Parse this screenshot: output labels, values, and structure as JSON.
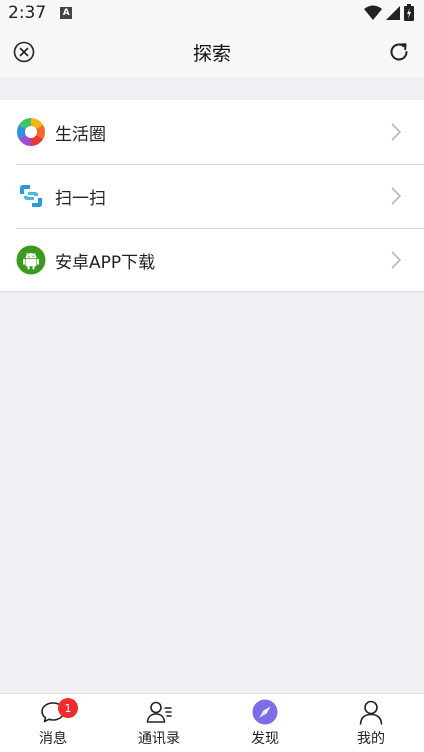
{
  "status_bar": {
    "time": "2:37",
    "notification_icon": "a-notification-icon"
  },
  "header": {
    "title": "探索",
    "left_icon": "close-circle-icon",
    "right_icon": "refresh-icon"
  },
  "menu": {
    "items": [
      {
        "label": "生活圈",
        "icon": "aperture-icon"
      },
      {
        "label": "扫一扫",
        "icon": "scan-icon"
      },
      {
        "label": "安卓APP下载",
        "icon": "android-icon"
      }
    ]
  },
  "tabbar": {
    "tabs": [
      {
        "label": "消息",
        "icon": "chat-bubble-icon",
        "badge": "1"
      },
      {
        "label": "通讯录",
        "icon": "contacts-icon"
      },
      {
        "label": "发现",
        "icon": "compass-icon",
        "active": true
      },
      {
        "label": "我的",
        "icon": "person-icon"
      }
    ]
  },
  "colors": {
    "active_tab": "#7b6ee8",
    "badge": "#f02b2b",
    "android_green": "#3a9a1e",
    "scan_blue": "#2a9ad6"
  }
}
